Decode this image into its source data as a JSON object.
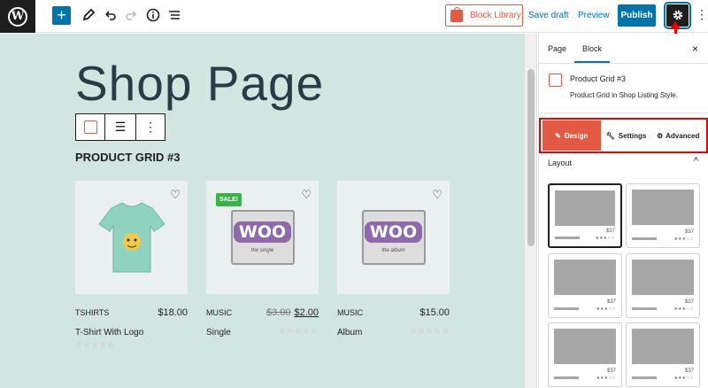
{
  "toolbar": {
    "wp_logo": "W",
    "block_library_label": "Block Library",
    "save_draft_label": "Save draft",
    "preview_label": "Preview",
    "publish_label": "Publish",
    "more_icon": "⋮"
  },
  "canvas": {
    "page_title": "Shop Page",
    "grid_title": "PRODUCT GRID #3",
    "products": [
      {
        "category": "TSHIRTS",
        "price": "$18.00",
        "name": "T-Shirt With Logo",
        "stars": "☆☆☆☆☆"
      },
      {
        "category": "MUSIC",
        "old_price": "$3.00",
        "price": "$2.00",
        "name": "Single",
        "badge": "SALE!",
        "woo_logo": "WOO",
        "woo_sub": "the single",
        "stars": "☆☆☆☆☆"
      },
      {
        "category": "MUSIC",
        "price": "$15.00",
        "name": "Album",
        "woo_logo": "WOO",
        "woo_sub": "the album",
        "stars": "☆☆☆☆☆"
      }
    ]
  },
  "sidebar": {
    "tabs": [
      "Page",
      "Block"
    ],
    "close": "×",
    "block_name": "Product Grid #3",
    "block_desc": "Product Grid in Shop Listing Style.",
    "panel_tabs": [
      "Design",
      "Settings",
      "Advanced"
    ],
    "layout_label": "Layout",
    "layout_price": "$37",
    "layout_stars": "★★★☆☆",
    "layout_chevron": "^"
  },
  "colors": {
    "accent": "#0073aa",
    "brand": "#e25a43",
    "canvas_bg": "#d3e5e0",
    "highlight": "#ee0000"
  }
}
